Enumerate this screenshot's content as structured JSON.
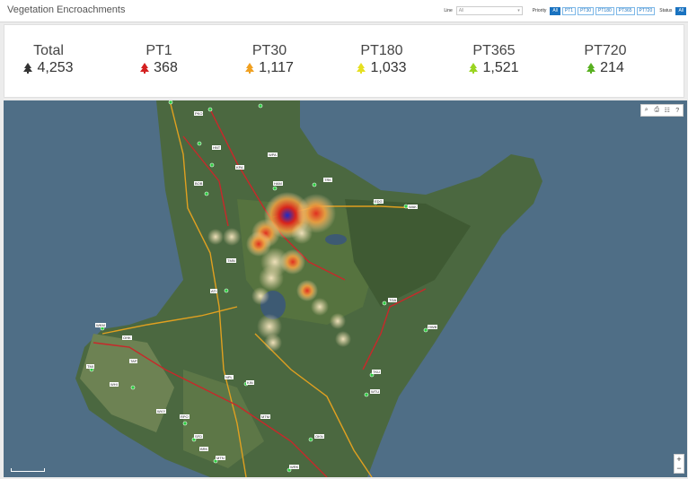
{
  "header": {
    "title": "Vegetation Encroachments",
    "line_label": "Line",
    "line_value": "All",
    "priority_label": "Priority",
    "priority_options": [
      "All",
      "PT1",
      "PT30",
      "PT180",
      "PT365",
      "PT720"
    ],
    "status_label": "Status",
    "status_value": "All"
  },
  "stats": [
    {
      "label": "Total",
      "value": "4,253",
      "color": "#333333"
    },
    {
      "label": "PT1",
      "value": "368",
      "color": "#d42020"
    },
    {
      "label": "PT30",
      "value": "1,117",
      "color": "#f0a020"
    },
    {
      "label": "PT180",
      "value": "1,033",
      "color": "#e6e020"
    },
    {
      "label": "PT365",
      "value": "1,521",
      "color": "#9ad420"
    },
    {
      "label": "PT720",
      "value": "214",
      "color": "#58b020"
    }
  ],
  "map": {
    "tool_icons": [
      "search-icon",
      "print-icon",
      "layers-icon",
      "help-icon"
    ],
    "zoom_in": "+",
    "zoom_out": "−",
    "site_labels": [
      "PKO",
      "HNT",
      "KPA",
      "BOB",
      "TRK",
      "EDG",
      "WAK",
      "ATI",
      "WKM",
      "OHK",
      "TMI",
      "WHI",
      "KIN",
      "NPL",
      "RPO",
      "SFD",
      "MTN",
      "WRK",
      "OKN",
      "TKU",
      "TGA",
      "HAM",
      "WTU",
      "MTM",
      "HWB",
      "WVY",
      "BRK",
      "TMN",
      "TAP",
      "WPA"
    ]
  }
}
